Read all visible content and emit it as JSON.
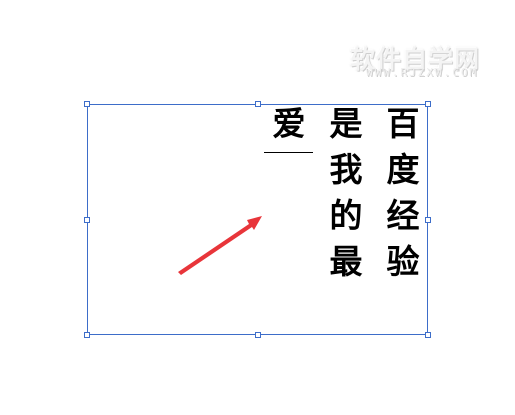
{
  "watermark": {
    "title": "软件自学网",
    "url": "WWW.RJZXW.COM"
  },
  "canvas": {
    "vertical_text": "百度经验\n是我的最\n爱"
  },
  "colors": {
    "selection": "#3d6dc9",
    "arrow": "#e8353a",
    "text": "#000000"
  },
  "icons": {
    "pointer": "red-arrow-icon"
  }
}
